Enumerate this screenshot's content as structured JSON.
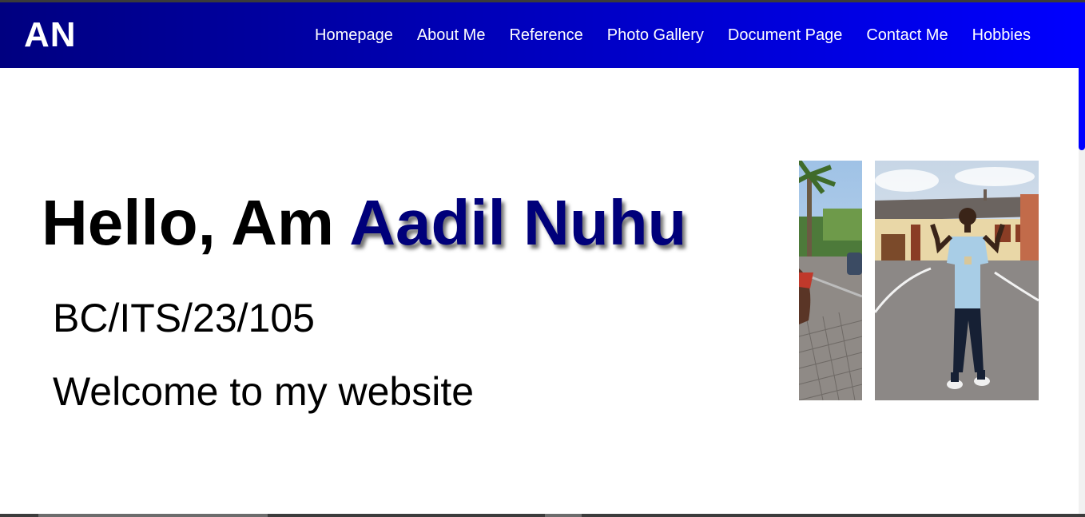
{
  "header": {
    "logo": "AN",
    "nav": [
      {
        "label": "Homepage"
      },
      {
        "label": "About Me"
      },
      {
        "label": "Reference"
      },
      {
        "label": "Photo Gallery"
      },
      {
        "label": "Document Page"
      },
      {
        "label": "Contact Me"
      },
      {
        "label": "Hobbies"
      }
    ]
  },
  "hero": {
    "greeting": "Hello, Am ",
    "name": "Aadil Nuhu",
    "student_id": "BC/ITS/23/105",
    "welcome": "Welcome to my website"
  },
  "colors": {
    "header_start": "#000080",
    "header_end": "#0000ff",
    "name_color": "#00007a"
  }
}
